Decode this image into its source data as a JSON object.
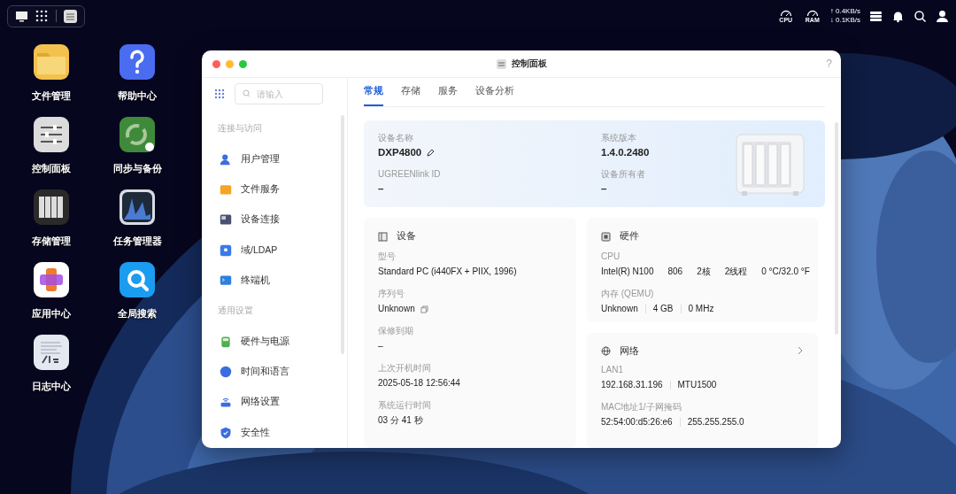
{
  "top_bar": {
    "gauges": [
      "CPU",
      "RAM"
    ],
    "net_up": "↑ 0.4KB/s",
    "net_down": "↓ 0.1KB/s"
  },
  "desktop_icons": [
    {
      "label": "文件管理",
      "kind": "folder"
    },
    {
      "label": "帮助中心",
      "kind": "help"
    },
    {
      "label": "控制面板",
      "kind": "control"
    },
    {
      "label": "同步与备份",
      "kind": "sync"
    },
    {
      "label": "存储管理",
      "kind": "storage"
    },
    {
      "label": "任务管理器",
      "kind": "monitor"
    },
    {
      "label": "应用中心",
      "kind": "apps"
    },
    {
      "label": "全局搜索",
      "kind": "search"
    },
    {
      "label": "日志中心",
      "kind": "logs"
    }
  ],
  "window": {
    "title": "控制面板",
    "help": "?",
    "search": {
      "placeholder": "请输入"
    },
    "sidebar": [
      {
        "title": "连接与访问",
        "items": [
          {
            "label": "用户管理",
            "kind": "user"
          },
          {
            "label": "文件服务",
            "kind": "folder"
          },
          {
            "label": "设备连接",
            "kind": "device"
          },
          {
            "label": "域/LDAP",
            "kind": "ldap"
          },
          {
            "label": "终端机",
            "kind": "terminal"
          }
        ]
      },
      {
        "title": "通用设置",
        "items": [
          {
            "label": "硬件与电源",
            "kind": "hardware"
          },
          {
            "label": "时间和语言",
            "kind": "time"
          },
          {
            "label": "网络设置",
            "kind": "network"
          },
          {
            "label": "安全性",
            "kind": "security"
          }
        ]
      }
    ],
    "tabs": [
      {
        "label": "常规",
        "selected": true
      },
      {
        "label": "存储",
        "selected": false
      },
      {
        "label": "服务",
        "selected": false
      },
      {
        "label": "设备分析",
        "selected": false
      }
    ],
    "summary": [
      {
        "label": "设备名称",
        "value": "DXP4800",
        "editable": true
      },
      {
        "label": "系统版本",
        "value": "1.4.0.2480",
        "editable": false
      },
      {
        "label": "UGREENlink ID",
        "value": "–",
        "editable": false
      },
      {
        "label": "设备所有者",
        "value": "–",
        "editable": false
      }
    ],
    "device_card": {
      "title": "设备",
      "fields": [
        {
          "label": "型号",
          "values": [
            "Standard PC (i440FX + PIIX, 1996)"
          ],
          "copyable": false
        },
        {
          "label": "序列号",
          "values": [
            "Unknown"
          ],
          "copyable": true
        },
        {
          "label": "保修到期",
          "values": [
            "–"
          ],
          "copyable": false
        },
        {
          "label": "上次开机时间",
          "values": [
            "2025-05-18 12:56:44"
          ],
          "copyable": false
        },
        {
          "label": "系统运行时间",
          "values": [
            "03 分 41 秒"
          ],
          "copyable": false
        }
      ]
    },
    "hardware_card": {
      "title": "硬件",
      "fields": [
        {
          "label": "CPU",
          "values": [
            "Intel(R) N100",
            "806",
            "2核",
            "2线程",
            "0 °C/32.0 °F"
          ]
        },
        {
          "label": "内存 (QEMU)",
          "values": [
            "Unknown",
            "4 GB",
            "0 MHz"
          ]
        }
      ]
    },
    "network_card": {
      "title": "网络",
      "fields": [
        {
          "label": "LAN1",
          "values": [
            "192.168.31.196",
            "MTU1500"
          ]
        },
        {
          "label": "MAC地址1/子网掩码",
          "values": [
            "52:54:00:d5:26:e6",
            "255.255.255.0"
          ]
        }
      ]
    }
  }
}
